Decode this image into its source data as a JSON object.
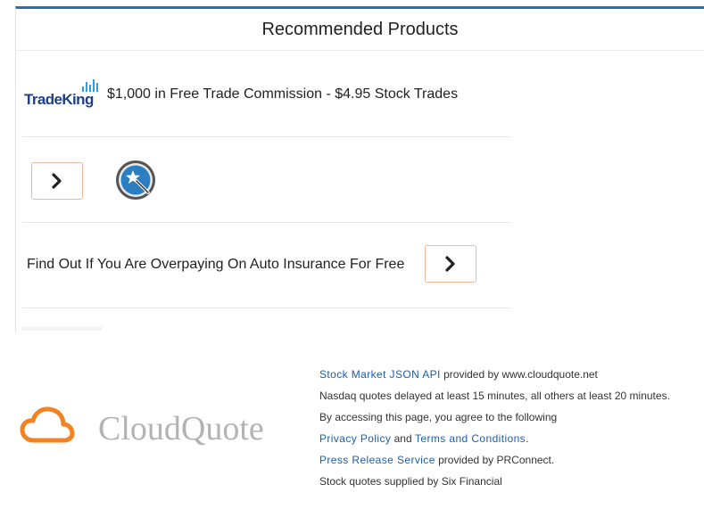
{
  "recommended": {
    "title": "Recommended Products",
    "items": [
      {
        "logo_text": "TradeKing",
        "text": "$1,000 in Free Trade Commission - $4.95 Stock Trades"
      },
      {
        "badge_icon": "magic-wand-badge-icon",
        "arrow_icon": "chevron-right-icon"
      },
      {
        "text": "Find Out If You Are Overpaying On Auto Insurance For Free",
        "arrow_icon": "chevron-right-icon"
      }
    ],
    "colors": {
      "accent": "#2a6fb0",
      "button_border": "#f0b69b"
    }
  },
  "footer": {
    "brand": "CloudQuote",
    "logo_color": "#f58220",
    "line1": {
      "link": "Stock Market JSON API",
      "rest": " provided by www.cloudquote.net"
    },
    "line2": "Nasdaq quotes delayed at least 15 minutes, all others at least 20 minutes.",
    "line3": "By accessing this page, you agree to the following",
    "line4": {
      "link1": "Privacy Policy",
      "and": " and ",
      "link2": "Terms and Conditions",
      "end": "."
    },
    "line5": {
      "link": "Press Release Service",
      "rest": " provided by PRConnect."
    },
    "line6": "Stock quotes supplied by Six Financial"
  }
}
